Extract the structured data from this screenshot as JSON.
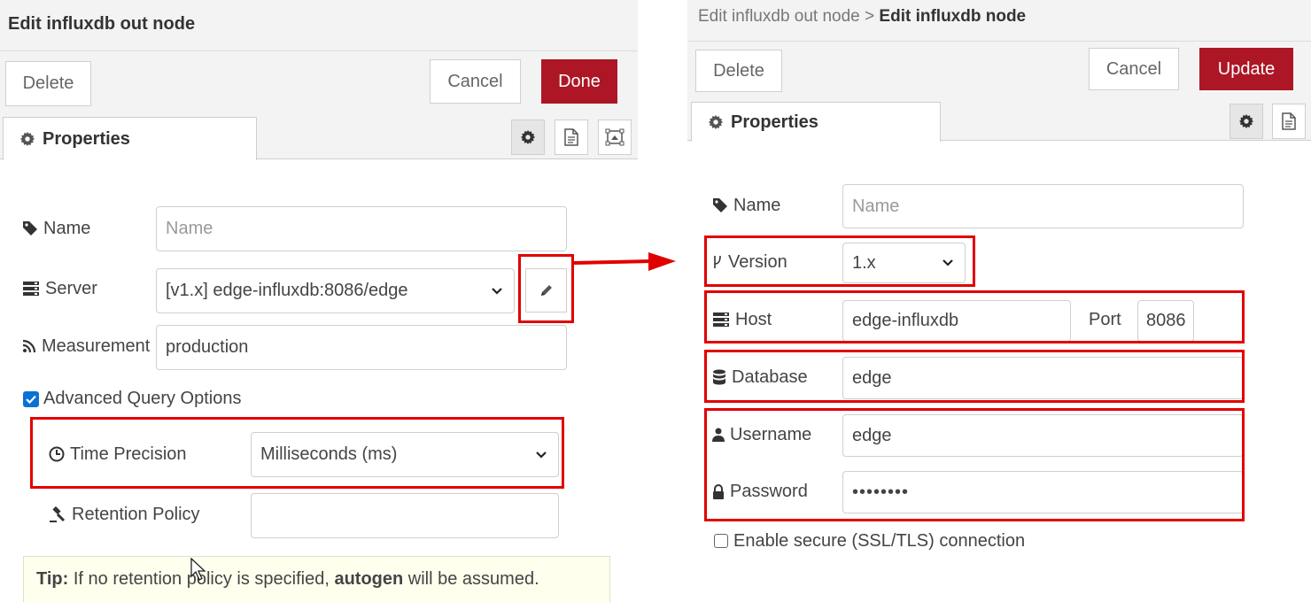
{
  "left_panel": {
    "title": "Edit influxdb out node",
    "buttons": {
      "delete": "Delete",
      "cancel": "Cancel",
      "done": "Done"
    },
    "tab": {
      "label": "Properties"
    },
    "fields": {
      "name": {
        "label": "Name",
        "placeholder": "Name",
        "value": ""
      },
      "server": {
        "label": "Server",
        "value": "[v1.x] edge-influxdb:8086/edge"
      },
      "measurement": {
        "label": "Measurement",
        "value": "production"
      },
      "advanced": {
        "label": "Advanced Query Options",
        "checked": true
      },
      "time_precision": {
        "label": "Time Precision",
        "value": "Milliseconds (ms)"
      },
      "retention_policy": {
        "label": "Retention Policy",
        "value": ""
      }
    },
    "tip": {
      "prefix": "Tip:",
      "text1": " If no retention policy is specified, ",
      "bold": "autogen",
      "text2": " will be assumed."
    }
  },
  "right_panel": {
    "breadcrumb_parent": "Edit influxdb out node",
    "breadcrumb_separator": ">",
    "breadcrumb_current": "Edit influxdb node",
    "buttons": {
      "delete": "Delete",
      "cancel": "Cancel",
      "update": "Update"
    },
    "tab": {
      "label": "Properties"
    },
    "fields": {
      "name": {
        "label": "Name",
        "placeholder": "Name",
        "value": ""
      },
      "version": {
        "label": "Version",
        "value": "1.x"
      },
      "host": {
        "label": "Host",
        "value": "edge-influxdb"
      },
      "port": {
        "label": "Port",
        "value": "8086"
      },
      "database": {
        "label": "Database",
        "value": "edge"
      },
      "username": {
        "label": "Username",
        "value": "edge"
      },
      "password": {
        "label": "Password",
        "value": "••••••••"
      },
      "ssl": {
        "label": "Enable secure (SSL/TLS) connection",
        "checked": false
      }
    }
  },
  "colors": {
    "primary_button": "#ad1625",
    "highlight_box": "#e10000",
    "checkbox_checked": "#0a72d6",
    "tip_background": "#ffffee"
  }
}
